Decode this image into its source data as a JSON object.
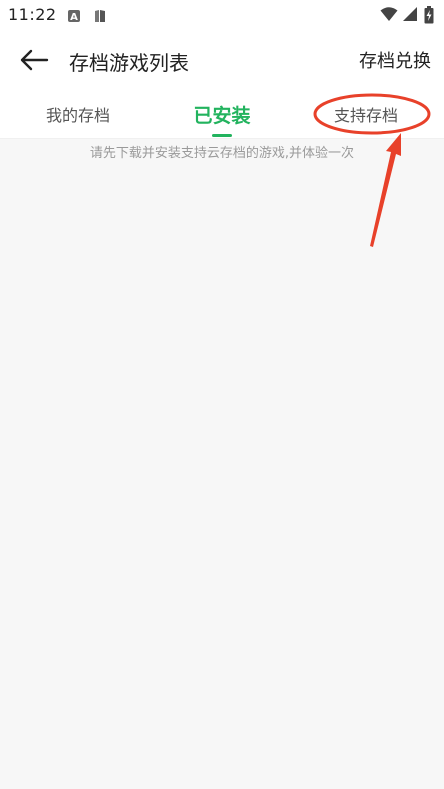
{
  "status_bar": {
    "time": "11:22",
    "app_icons": [
      "a-box-icon",
      "book-icon"
    ],
    "right_icons": [
      "wifi-icon",
      "signal-icon",
      "battery-charging-icon"
    ]
  },
  "header": {
    "title": "存档游戏列表",
    "action_label": "存档兑换"
  },
  "tabs": [
    {
      "label": "我的存档",
      "active": false
    },
    {
      "label": "已安装",
      "active": true
    },
    {
      "label": "支持存档",
      "active": false
    }
  ],
  "content": {
    "empty_hint": "请先下载并安装支持云存档的游戏,并体验一次"
  },
  "colors": {
    "accent": "#22b35e",
    "annotation": "#e8412a"
  }
}
